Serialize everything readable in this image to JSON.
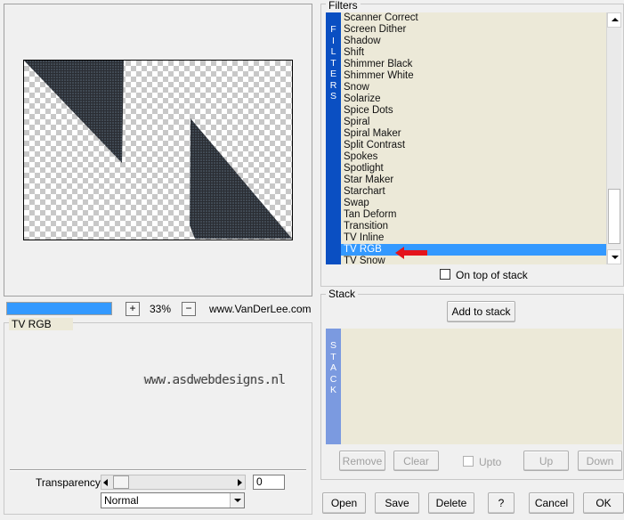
{
  "filters_section": {
    "title": "Filters",
    "side_label": [
      "F",
      "I",
      "L",
      "T",
      "E",
      "R",
      "S"
    ],
    "items": [
      "Scanner Correct",
      "Screen Dither",
      "Shadow",
      "Shift",
      "Shimmer Black",
      "Shimmer White",
      "Snow",
      "Solarize",
      "Spice Dots",
      "Spiral",
      "Spiral Maker",
      "Split Contrast",
      "Spokes",
      "Spotlight",
      "Star Maker",
      "Starchart",
      "Swap",
      "Tan Deform",
      "Transition",
      "TV Inline",
      "TV RGB",
      "TV Snow"
    ],
    "selected_index": 20,
    "on_top_label": "On top of stack"
  },
  "stack_section": {
    "title": "Stack",
    "side_label": [
      "S",
      "T",
      "A",
      "C",
      "K"
    ],
    "add_button": "Add to stack",
    "remove_button": "Remove",
    "clear_button": "Clear",
    "upto_label": "Upto",
    "up_button": "Up",
    "down_button": "Down"
  },
  "zoom_bar": {
    "plus": "+",
    "minus": "−",
    "zoom_value": "33%",
    "website": "www.VanDerLee.com",
    "progress": 1.0
  },
  "settings_section": {
    "title": "TV RGB",
    "watermark": "www.asdwebdesigns.nl",
    "transparency_label": "Transparency",
    "transparency_value": "0",
    "blend_mode": "Normal"
  },
  "footer_buttons": {
    "open": "Open",
    "save": "Save",
    "delete": "Delete",
    "help": "?",
    "cancel": "Cancel",
    "ok": "OK"
  },
  "colors": {
    "accent_blue": "#0a4fc2",
    "selection_blue": "#3399ff",
    "list_bg": "#ece9d8",
    "stack_side": "#7b9ae0",
    "arrow_red": "#e4141b"
  }
}
